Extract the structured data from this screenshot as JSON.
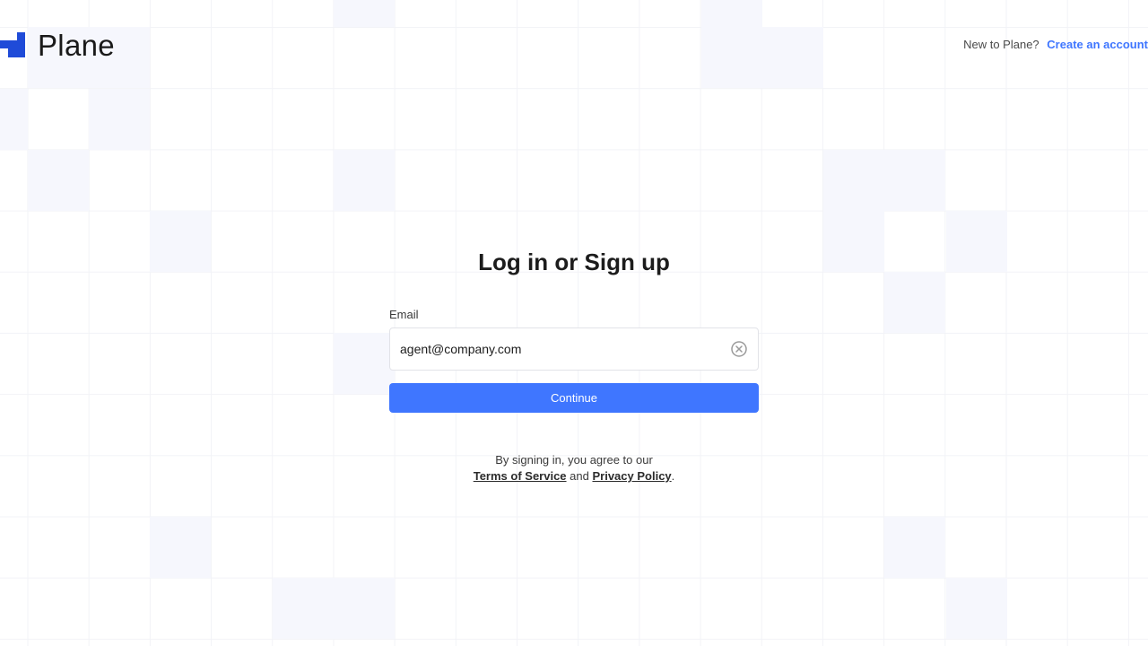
{
  "brand": {
    "logo_text": "Plane",
    "logo_color": "#1f4bd8"
  },
  "header": {
    "signup_prompt": "New to Plane?",
    "signup_link": "Create an account"
  },
  "form": {
    "title": "Log in or Sign up",
    "email_label": "Email",
    "email_value": "agent@company.com",
    "continue_label": "Continue",
    "clear_icon": "circle-x-icon"
  },
  "legal": {
    "prefix": "By signing in, you agree to our",
    "terms_link": "Terms of Service",
    "and_text": "and",
    "privacy_link": "Privacy Policy",
    "period": "."
  },
  "colors": {
    "accent": "#3f76ff",
    "grid_tile": "#f6f7fd"
  }
}
